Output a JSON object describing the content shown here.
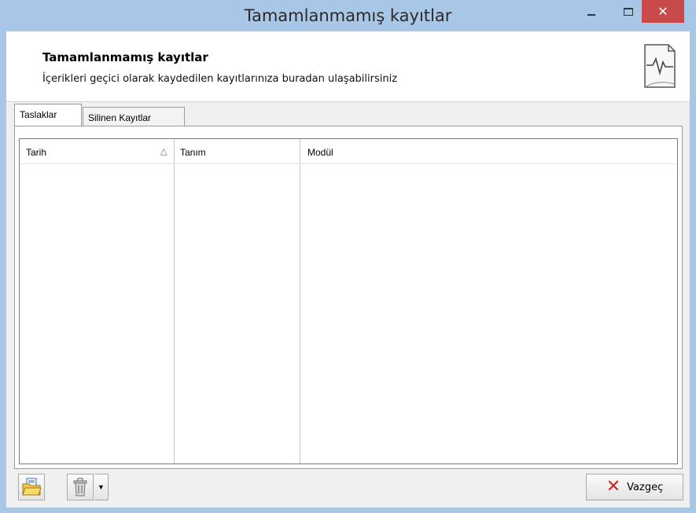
{
  "window": {
    "title": "Tamamlanmamış kayıtlar",
    "controls": {
      "minimize": "–",
      "maximize": "□",
      "close": "✕"
    }
  },
  "header": {
    "title": "Tamamlanmamış kayıtlar",
    "subtitle": "İçerikleri geçici olarak kaydedilen kayıtlarınıza buradan ulaşabilirsiniz",
    "icon": "document-chart-icon"
  },
  "tabs": [
    {
      "label": "Taslaklar",
      "active": true
    },
    {
      "label": "Silinen Kayıtlar",
      "active": false
    }
  ],
  "grid": {
    "columns": [
      {
        "label": "Tarih",
        "sort": "ascending"
      },
      {
        "label": "Tanım"
      },
      {
        "label": "Modül"
      }
    ],
    "rows": []
  },
  "footer": {
    "open_icon": "open-folder-icon",
    "delete_icon": "trash-icon",
    "cancel_label": "Vazgeç"
  },
  "colors": {
    "titlebar": "#a8c6e6",
    "close_button": "#c94a4a",
    "cancel_x": "#d0261f"
  }
}
